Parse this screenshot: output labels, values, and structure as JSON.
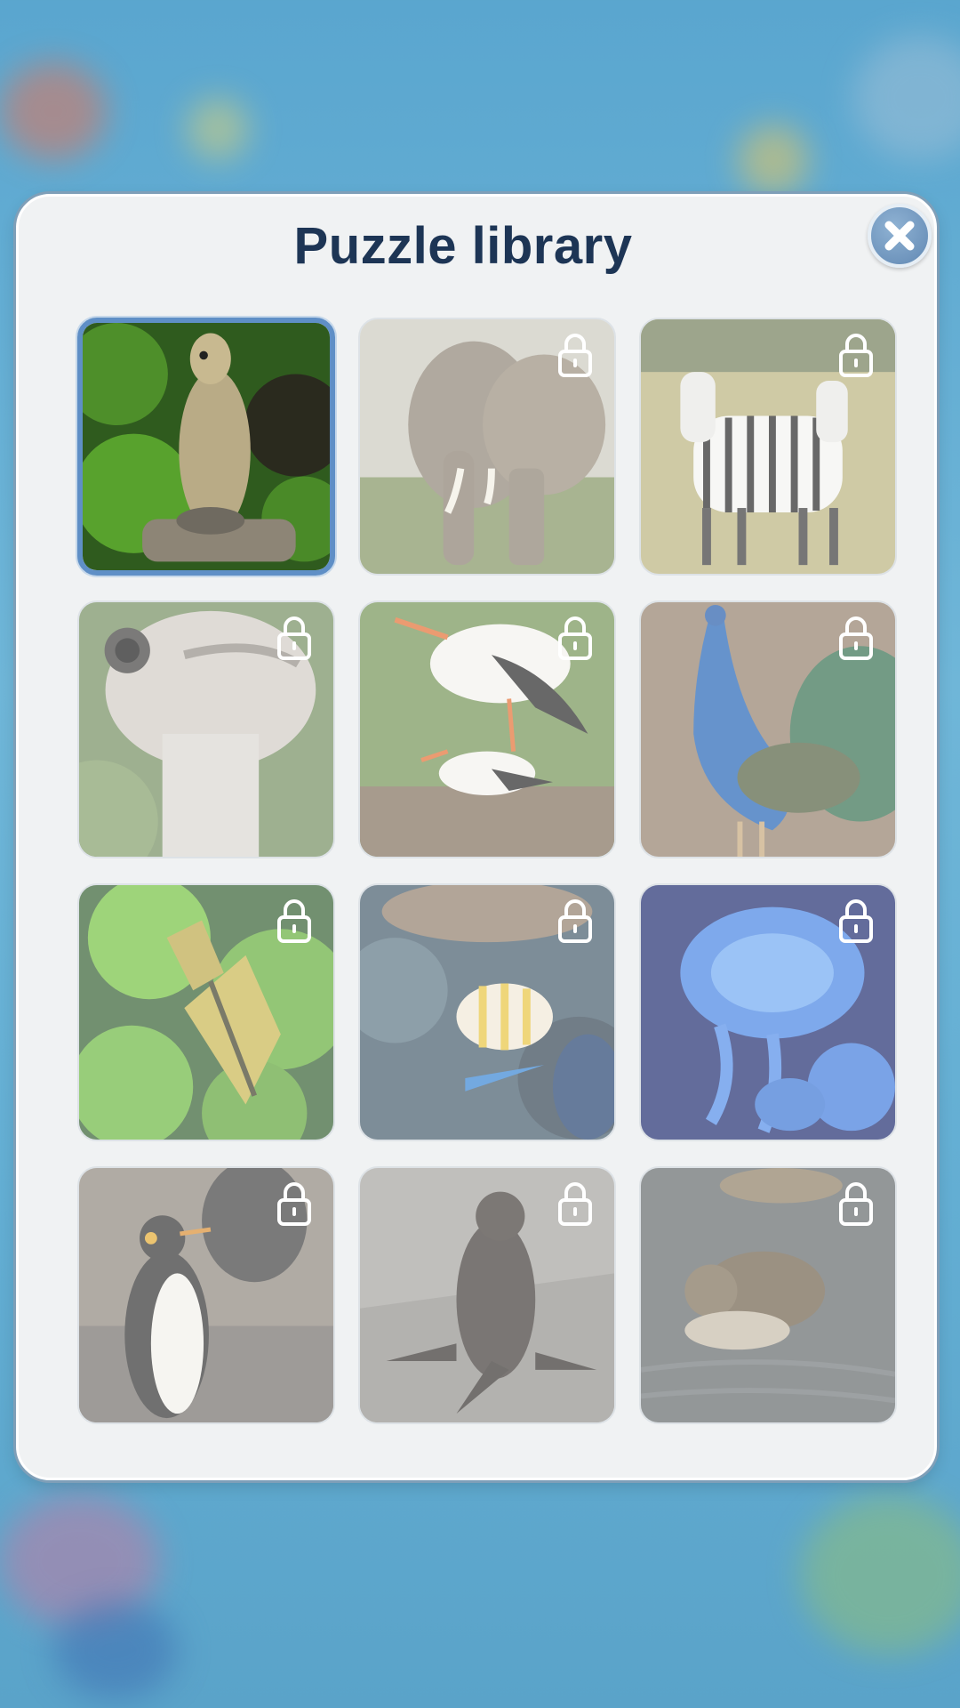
{
  "dialog": {
    "title": "Puzzle library",
    "close_icon": "close-icon"
  },
  "puzzles": [
    {
      "subject": "meerkat",
      "state": "selected"
    },
    {
      "subject": "elephant",
      "state": "locked"
    },
    {
      "subject": "zebras",
      "state": "locked"
    },
    {
      "subject": "ostrich",
      "state": "locked"
    },
    {
      "subject": "storks",
      "state": "locked"
    },
    {
      "subject": "peacock",
      "state": "locked"
    },
    {
      "subject": "angelfish",
      "state": "locked"
    },
    {
      "subject": "butterflyfish",
      "state": "locked"
    },
    {
      "subject": "jellyfish",
      "state": "locked"
    },
    {
      "subject": "penguin",
      "state": "locked"
    },
    {
      "subject": "sea-lion",
      "state": "locked"
    },
    {
      "subject": "duckling",
      "state": "locked"
    }
  ],
  "colors": {
    "title": "#1d3555",
    "dialog_background": "#f0f2f3",
    "selected_border": "#5f8fc6",
    "close_button": "#6f95bd"
  }
}
